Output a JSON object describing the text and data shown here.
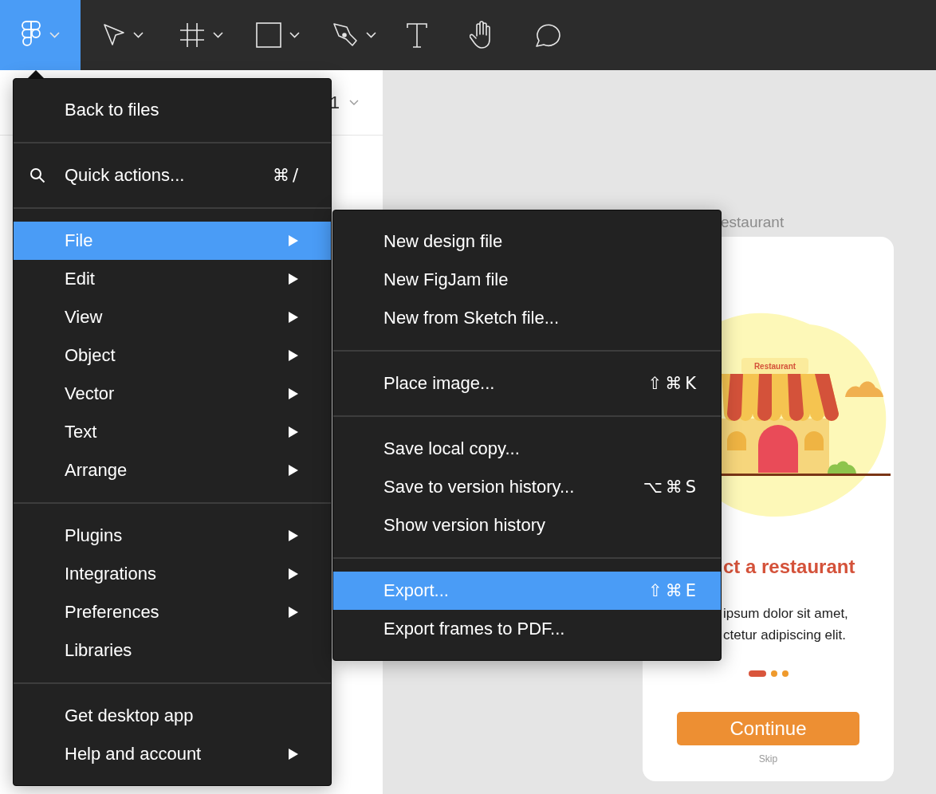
{
  "toolbar": {
    "tools": [
      {
        "kind": "logo",
        "selected": true,
        "dropdown": true
      },
      {
        "kind": "move",
        "selected": false,
        "dropdown": true
      },
      {
        "kind": "frame",
        "selected": false,
        "dropdown": true
      },
      {
        "kind": "rectangle",
        "selected": false,
        "dropdown": true
      },
      {
        "kind": "pen",
        "selected": false,
        "dropdown": true
      },
      {
        "kind": "text",
        "selected": false,
        "dropdown": false
      },
      {
        "kind": "hand",
        "selected": false,
        "dropdown": false
      },
      {
        "kind": "comment",
        "selected": false,
        "dropdown": false
      }
    ]
  },
  "page_selector": {
    "label": "1"
  },
  "main_menu": {
    "items": [
      {
        "kind": "item",
        "label": "Back to files",
        "submenu": false,
        "selected": false
      },
      {
        "kind": "separator"
      },
      {
        "kind": "search",
        "label": "Quick actions...",
        "shortcut": "⌘/",
        "submenu": false,
        "selected": false
      },
      {
        "kind": "separator"
      },
      {
        "kind": "item",
        "label": "File",
        "submenu": true,
        "selected": true
      },
      {
        "kind": "item",
        "label": "Edit",
        "submenu": true,
        "selected": false
      },
      {
        "kind": "item",
        "label": "View",
        "submenu": true,
        "selected": false
      },
      {
        "kind": "item",
        "label": "Object",
        "submenu": true,
        "selected": false
      },
      {
        "kind": "item",
        "label": "Vector",
        "submenu": true,
        "selected": false
      },
      {
        "kind": "item",
        "label": "Text",
        "submenu": true,
        "selected": false
      },
      {
        "kind": "item",
        "label": "Arrange",
        "submenu": true,
        "selected": false
      },
      {
        "kind": "separator"
      },
      {
        "kind": "item",
        "label": "Plugins",
        "submenu": true,
        "selected": false
      },
      {
        "kind": "item",
        "label": "Integrations",
        "submenu": true,
        "selected": false
      },
      {
        "kind": "item",
        "label": "Preferences",
        "submenu": true,
        "selected": false
      },
      {
        "kind": "item",
        "label": "Libraries",
        "submenu": false,
        "selected": false
      },
      {
        "kind": "separator"
      },
      {
        "kind": "item",
        "label": "Get desktop app",
        "submenu": false,
        "selected": false
      },
      {
        "kind": "item",
        "label": "Help and account",
        "submenu": true,
        "selected": false
      }
    ]
  },
  "file_submenu": {
    "items": [
      {
        "kind": "item",
        "label": "New design file",
        "selected": false
      },
      {
        "kind": "item",
        "label": "New FigJam file",
        "selected": false
      },
      {
        "kind": "item",
        "label": "New from Sketch file...",
        "selected": false
      },
      {
        "kind": "separator"
      },
      {
        "kind": "item",
        "label": "Place image...",
        "shortcut": "⇧⌘K",
        "selected": false
      },
      {
        "kind": "separator"
      },
      {
        "kind": "item",
        "label": "Save local copy...",
        "selected": false
      },
      {
        "kind": "item",
        "label": "Save to version history...",
        "shortcut": "⌥⌘S",
        "selected": false
      },
      {
        "kind": "item",
        "label": "Show version history",
        "selected": false
      },
      {
        "kind": "separator"
      },
      {
        "kind": "item",
        "label": "Export...",
        "shortcut": "⇧⌘E",
        "selected": true
      },
      {
        "kind": "item",
        "label": "Export frames to PDF...",
        "selected": false
      }
    ]
  },
  "canvas": {
    "frame_label": "estaurant",
    "card": {
      "sign": "Restaurant",
      "title": "ct a restaurant",
      "body": [
        "ipsum dolor sit amet,",
        "ctetur adipiscing elit."
      ],
      "pager": [
        {
          "selected": true
        },
        {
          "selected": false
        },
        {
          "selected": false
        }
      ],
      "button": "Continue",
      "skip": "Skip"
    }
  }
}
